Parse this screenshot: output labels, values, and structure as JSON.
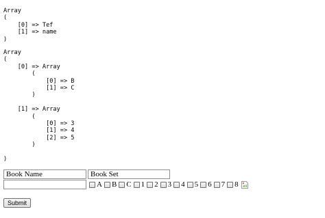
{
  "output": {
    "array1": "Array\n(\n    [0] => Tef\n    [1] => name\n)",
    "array2": "Array\n(\n    [0] => Array\n        (\n            [0] => B\n            [1] => C\n        )\n\n    [1] => Array\n        (\n            [0] => 3\n            [1] => 4\n            [2] => 5\n        )\n\n)"
  },
  "form": {
    "book_name_header": "Book Name",
    "book_set_header": "Book Set",
    "book_name_value": "",
    "options": [
      {
        "label": "A",
        "checked": false
      },
      {
        "label": "B",
        "checked": false
      },
      {
        "label": "C",
        "checked": false
      },
      {
        "label": "1",
        "checked": false
      },
      {
        "label": "2",
        "checked": false
      },
      {
        "label": "3",
        "checked": false
      },
      {
        "label": "4",
        "checked": false
      },
      {
        "label": "5",
        "checked": false
      },
      {
        "label": "6",
        "checked": false
      },
      {
        "label": "7",
        "checked": false
      },
      {
        "label": "8",
        "checked": false
      }
    ],
    "add_icon": "broken-image-icon",
    "submit_label": "Submit"
  }
}
